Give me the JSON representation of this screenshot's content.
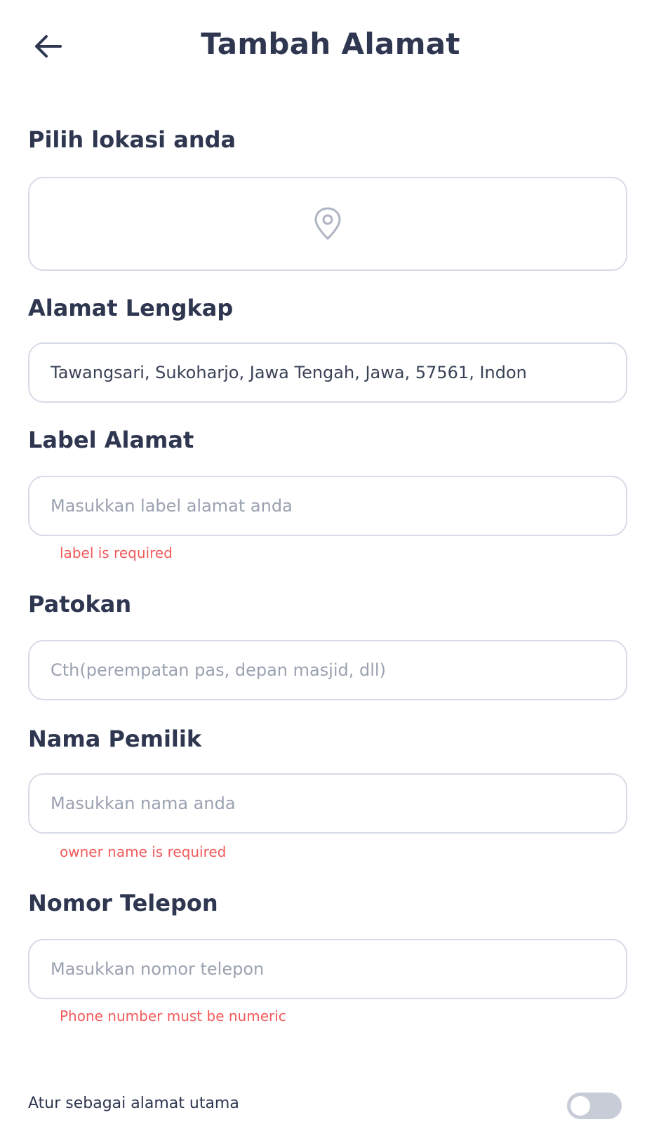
{
  "header": {
    "title": "Tambah Alamat",
    "back_icon": "arrow-left-icon"
  },
  "location": {
    "label": "Pilih lokasi anda",
    "icon": "map-pin-icon"
  },
  "address": {
    "label": "Alamat Lengkap",
    "value": "Tawangsari, Sukoharjo, Jawa Tengah, Jawa, 57561, Indon"
  },
  "address_label": {
    "label": "Label Alamat",
    "placeholder": "Masukkan label alamat anda",
    "error": "label is required"
  },
  "landmark": {
    "label": "Patokan",
    "placeholder": "Cth(perempatan pas, depan masjid, dll)"
  },
  "owner": {
    "label": "Nama Pemilik",
    "placeholder": "Masukkan nama anda",
    "error": "owner name is required"
  },
  "phone": {
    "label": "Nomor Telepon",
    "placeholder": "Masukkan nomor telepon",
    "error": "Phone number must be numeric"
  },
  "primary": {
    "label": "Atur sebagai alamat utama",
    "enabled": false
  },
  "colors": {
    "text": "#2e3650",
    "border": "#d7dbe6",
    "error": "#f25a5a",
    "toggle_off": "#c7ccd7"
  }
}
